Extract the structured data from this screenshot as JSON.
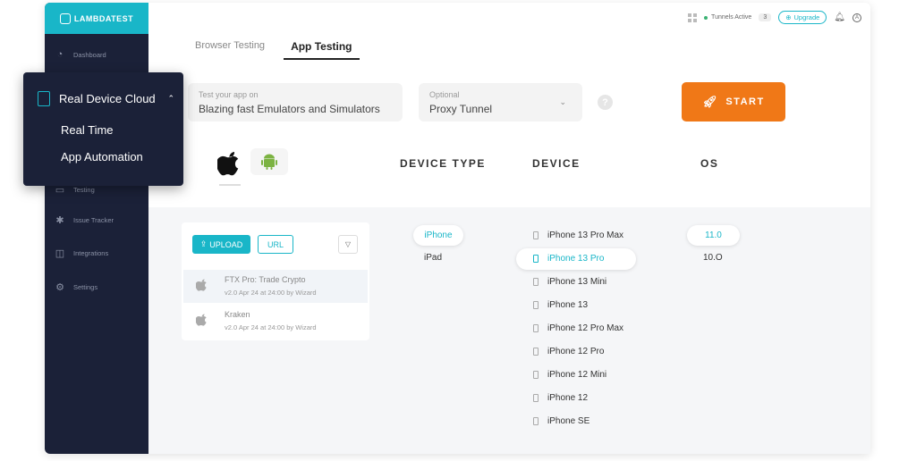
{
  "brand": {
    "logo_text": "LAMBDATEST"
  },
  "sidebar": {
    "items": [
      {
        "label": "Dashboard",
        "icon": "gauge-icon"
      },
      {
        "label": "Testing",
        "icon": "testing-icon"
      },
      {
        "label": "Issue Tracker",
        "icon": "bug-icon"
      },
      {
        "label": "Integrations",
        "icon": "integrations-icon"
      },
      {
        "label": "Settings",
        "icon": "gear-icon"
      }
    ]
  },
  "popup_menu": {
    "title": "Real Device Cloud",
    "items": [
      "Real Time",
      "App Automation"
    ]
  },
  "topbar": {
    "tunnel_status": "Tunnels Active",
    "tunnel_count": "3",
    "upgrade_label": "Upgrade"
  },
  "tabs": [
    {
      "label": "Browser Testing",
      "active": false
    },
    {
      "label": "App Testing",
      "active": true
    }
  ],
  "test_field": {
    "label": "Test your app on",
    "value": "Blazing fast Emulators and Simulators"
  },
  "tunnel_field": {
    "label": "Optional",
    "value": "Proxy Tunnel"
  },
  "help_symbol": "?",
  "start_label": "START",
  "columns": {
    "device_type": "DEVICE TYPE",
    "device": "DEVICE",
    "os": "OS"
  },
  "app_panel": {
    "upload_label": "UPLOAD",
    "url_label": "URL",
    "apps": [
      {
        "name": "FTX Pro: Trade Crypto",
        "meta": "v2.0 Apr 24 at 24:00 by Wizard"
      },
      {
        "name": "Kraken",
        "meta": "v2.0 Apr 24 at 24:00 by Wizard"
      }
    ]
  },
  "device_types": {
    "options": [
      "iPhone",
      "iPad"
    ],
    "selected": "iPhone"
  },
  "devices": {
    "options": [
      "iPhone 13 Pro Max",
      "iPhone 13 Pro",
      "iPhone 13 Mini",
      "iPhone 13",
      "iPhone 12 Pro Max",
      "iPhone 12 Pro",
      "iPhone 12 Mini",
      "iPhone 12",
      "iPhone SE"
    ],
    "selected": "iPhone 13 Pro"
  },
  "os_versions": {
    "options": [
      "11.0",
      "10.O"
    ],
    "selected": "11.0"
  },
  "colors": {
    "accent": "#19b6c8",
    "start": "#f07817",
    "sidebar": "#1b2138",
    "android": "#7cb342"
  }
}
